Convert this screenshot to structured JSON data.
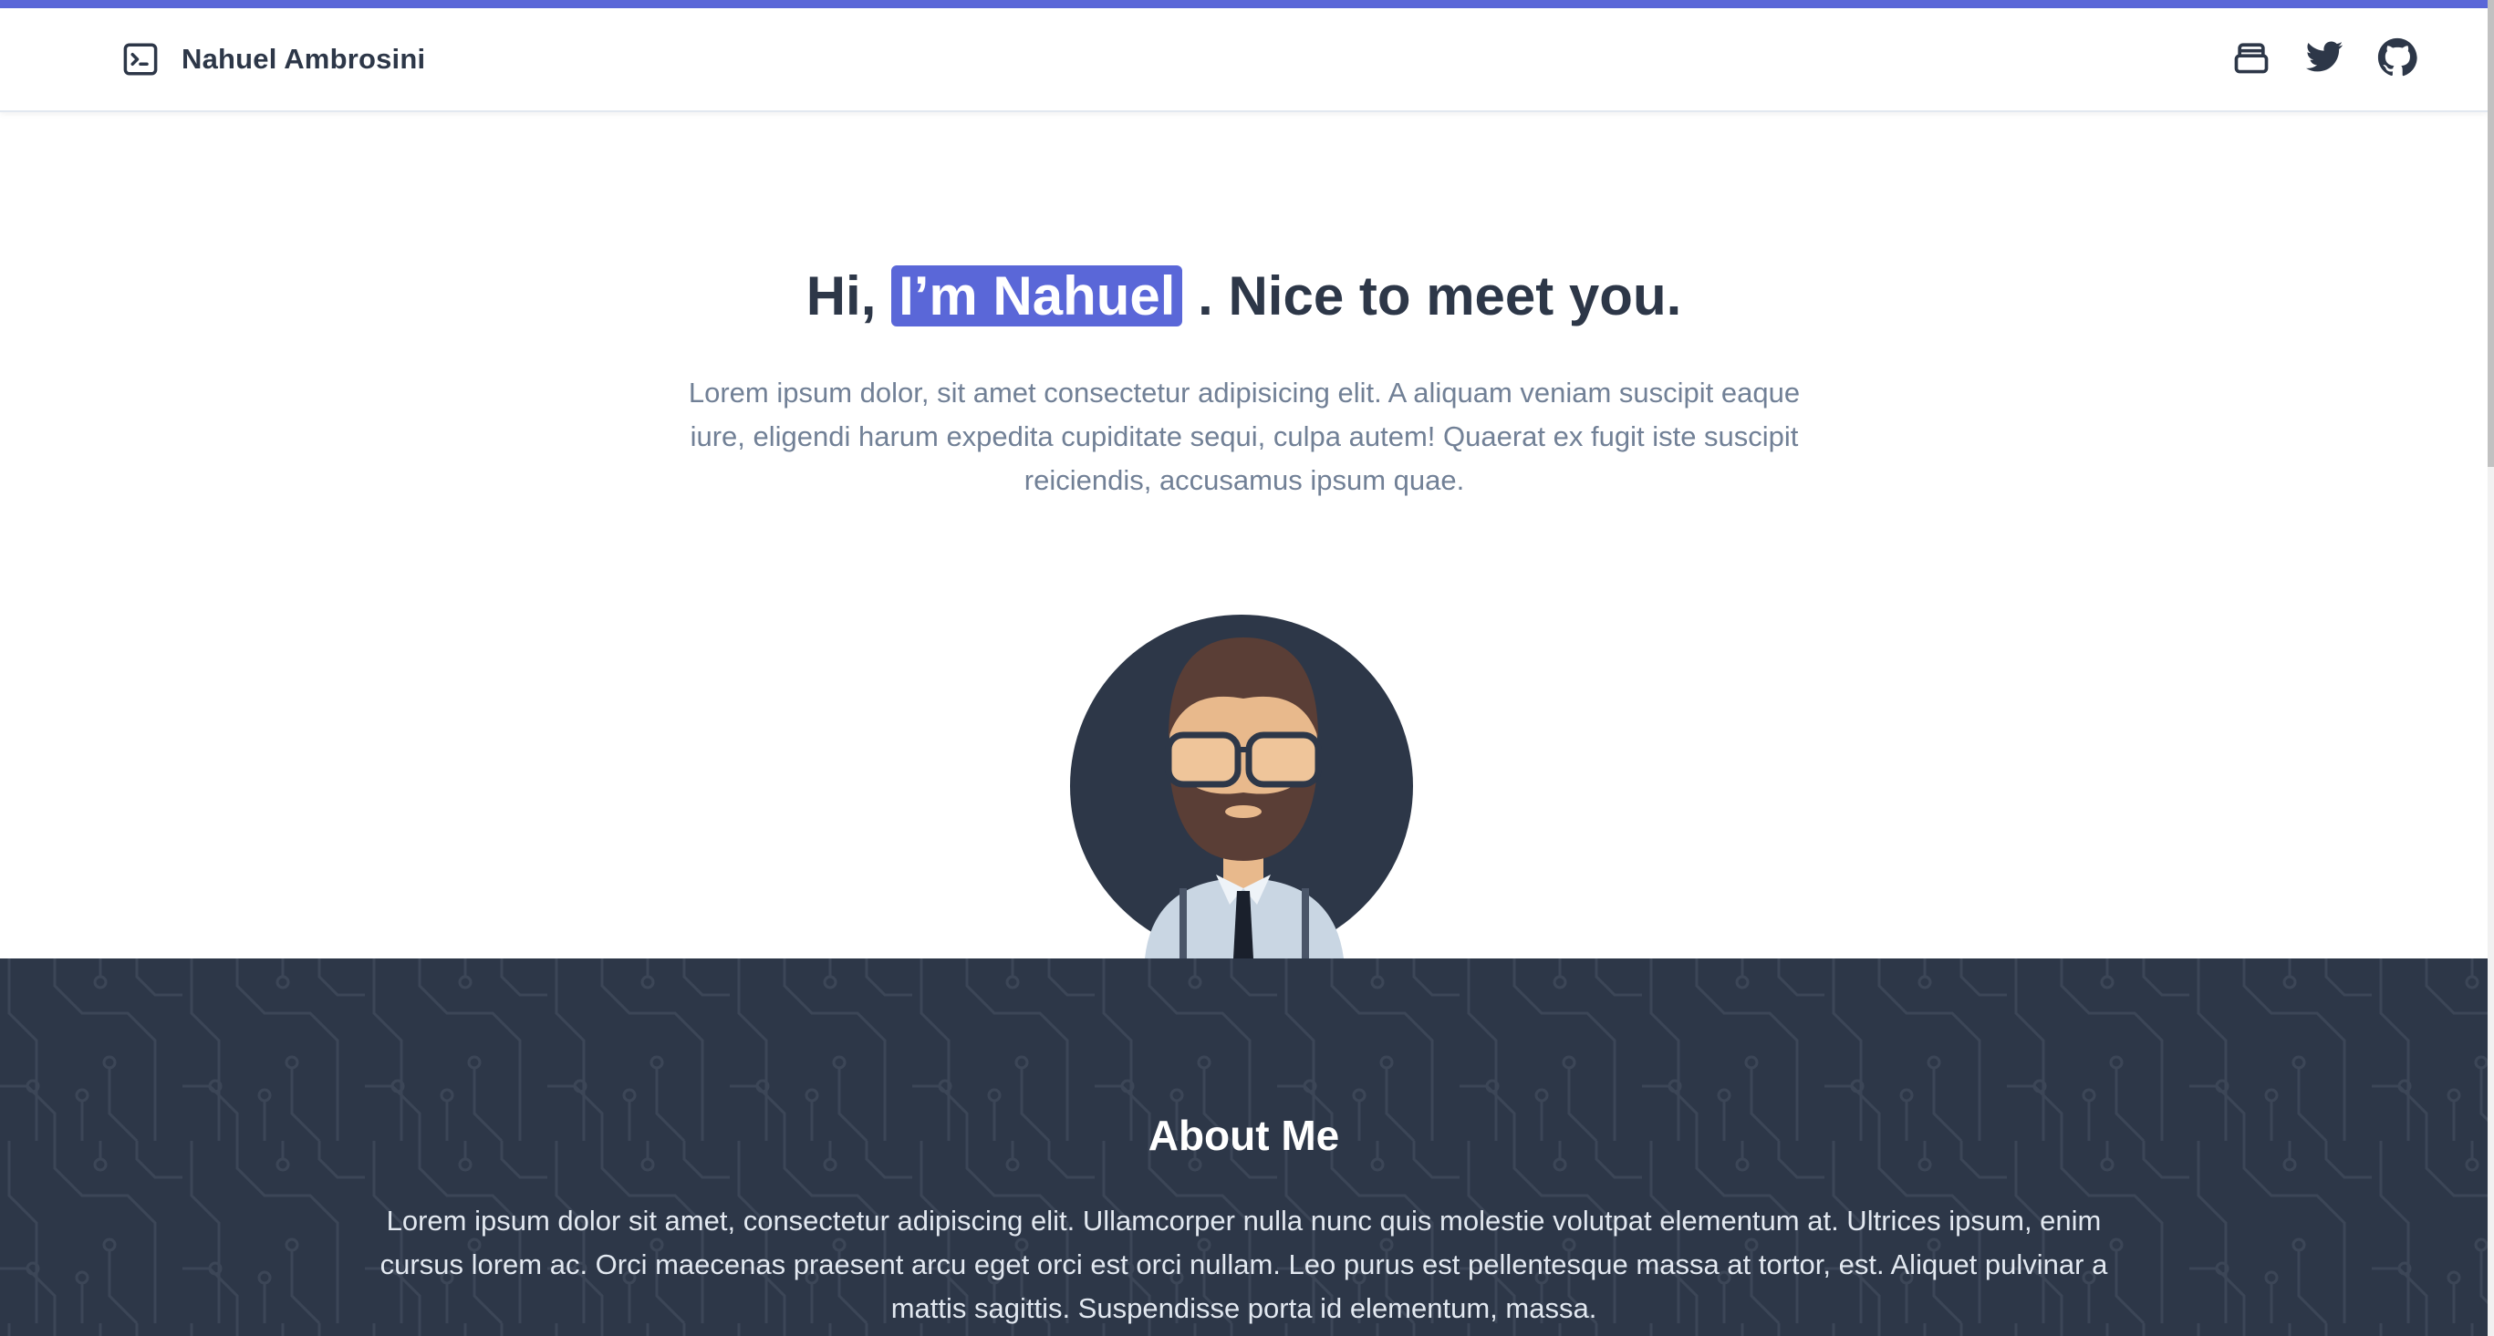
{
  "header": {
    "brand_name": "Nahuel Ambrosini",
    "brand_icon": "terminal-icon",
    "icons": [
      "stack-icon",
      "twitter-icon",
      "github-icon"
    ]
  },
  "hero": {
    "title_prefix": "Hi,",
    "title_highlight": "I’m Nahuel",
    "title_suffix": ". Nice to meet you.",
    "subtitle": "Lorem ipsum dolor, sit amet consectetur adipisicing elit. A aliquam veniam suscipit eaque iure, eligendi harum expedita cupiditate sequi, culpa autem! Quaerat ex fugit iste suscipit reiciendis, accusamus ipsum quae."
  },
  "about": {
    "title": "About Me",
    "text": "Lorem ipsum dolor sit amet, consectetur adipiscing elit. Ullamcorper nulla nunc quis molestie volutpat elementum at. Ultrices ipsum, enim cursus lorem ac. Orci maecenas praesent arcu eget orci est orci nullam. Leo purus est pellentesque massa at tortor, est. Aliquet pulvinar a mattis sagittis. Suspendisse porta id elementum, massa."
  },
  "colors": {
    "accent": "#5a67d8",
    "dark": "#2d3748",
    "muted_text": "#718096"
  }
}
